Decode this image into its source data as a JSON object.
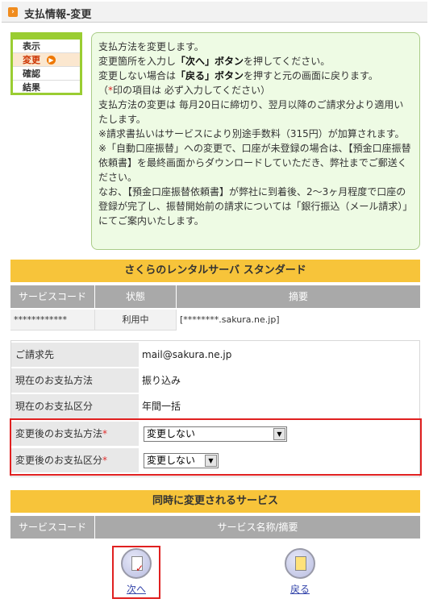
{
  "header": {
    "title": "支払情報-変更",
    "icon": "orange-arrow-icon"
  },
  "steps": [
    {
      "label": "表示",
      "active": false
    },
    {
      "label": "変更",
      "active": true
    },
    {
      "label": "確認",
      "active": false
    },
    {
      "label": "結果",
      "active": false
    }
  ],
  "info": {
    "line1": "支払方法を変更します。",
    "line2_a": "変更箇所を入力し",
    "line2_b": "「次へ」ボタン",
    "line2_c": "を押してください。",
    "line3_a": "変更しない場合は",
    "line3_b": "「戻る」ボタン",
    "line3_c": "を押すと元の画面に戻ります。",
    "line4_a": "（",
    "line4_mark": "*",
    "line4_b": "印の項目は 必ず入力してください）",
    "line5": "支払方法の変更は 毎月20日に締切り、翌月以降のご請求分より適用いたします。",
    "line6": "※請求書払いはサービスにより別途手数料（315円）が加算されます。",
    "line7": "※「自動口座振替」への変更で、口座が未登録の場合は、【預金口座振替依頼書】を最終画面からダウンロードしていただき、弊社までご郵送ください。",
    "line8": "なお、【預金口座振替依頼書】が弊社に到着後、2～3ヶ月程度で口座の登録が完了し、振替開始前の請求については「銀行振込（メール請求）」にてご案内いたします。"
  },
  "service": {
    "title": "さくらのレンタルサーバ スタンダード",
    "headers": [
      "サービスコード",
      "状態",
      "摘要"
    ],
    "row": [
      "************",
      "利用中",
      "[********.sakura.ne.jp]"
    ]
  },
  "account": {
    "rows": [
      {
        "label": "ご請求先",
        "value": "mail@sakura.ne.jp"
      },
      {
        "label": "現在のお支払方法",
        "value": "振り込み"
      },
      {
        "label": "現在のお支払区分",
        "value": "年間一括"
      }
    ],
    "method_label": "変更後のお支払方法",
    "method_value": "変更しない",
    "category_label": "変更後のお支払区分",
    "category_value": "変更しない",
    "required_mark": "*"
  },
  "simultaneous": {
    "title": "同時に変更されるサービス",
    "headers": [
      "サービスコード",
      "サービス名称/摘要"
    ]
  },
  "buttons": {
    "next_label": "次へ",
    "back_label": "戻る"
  }
}
